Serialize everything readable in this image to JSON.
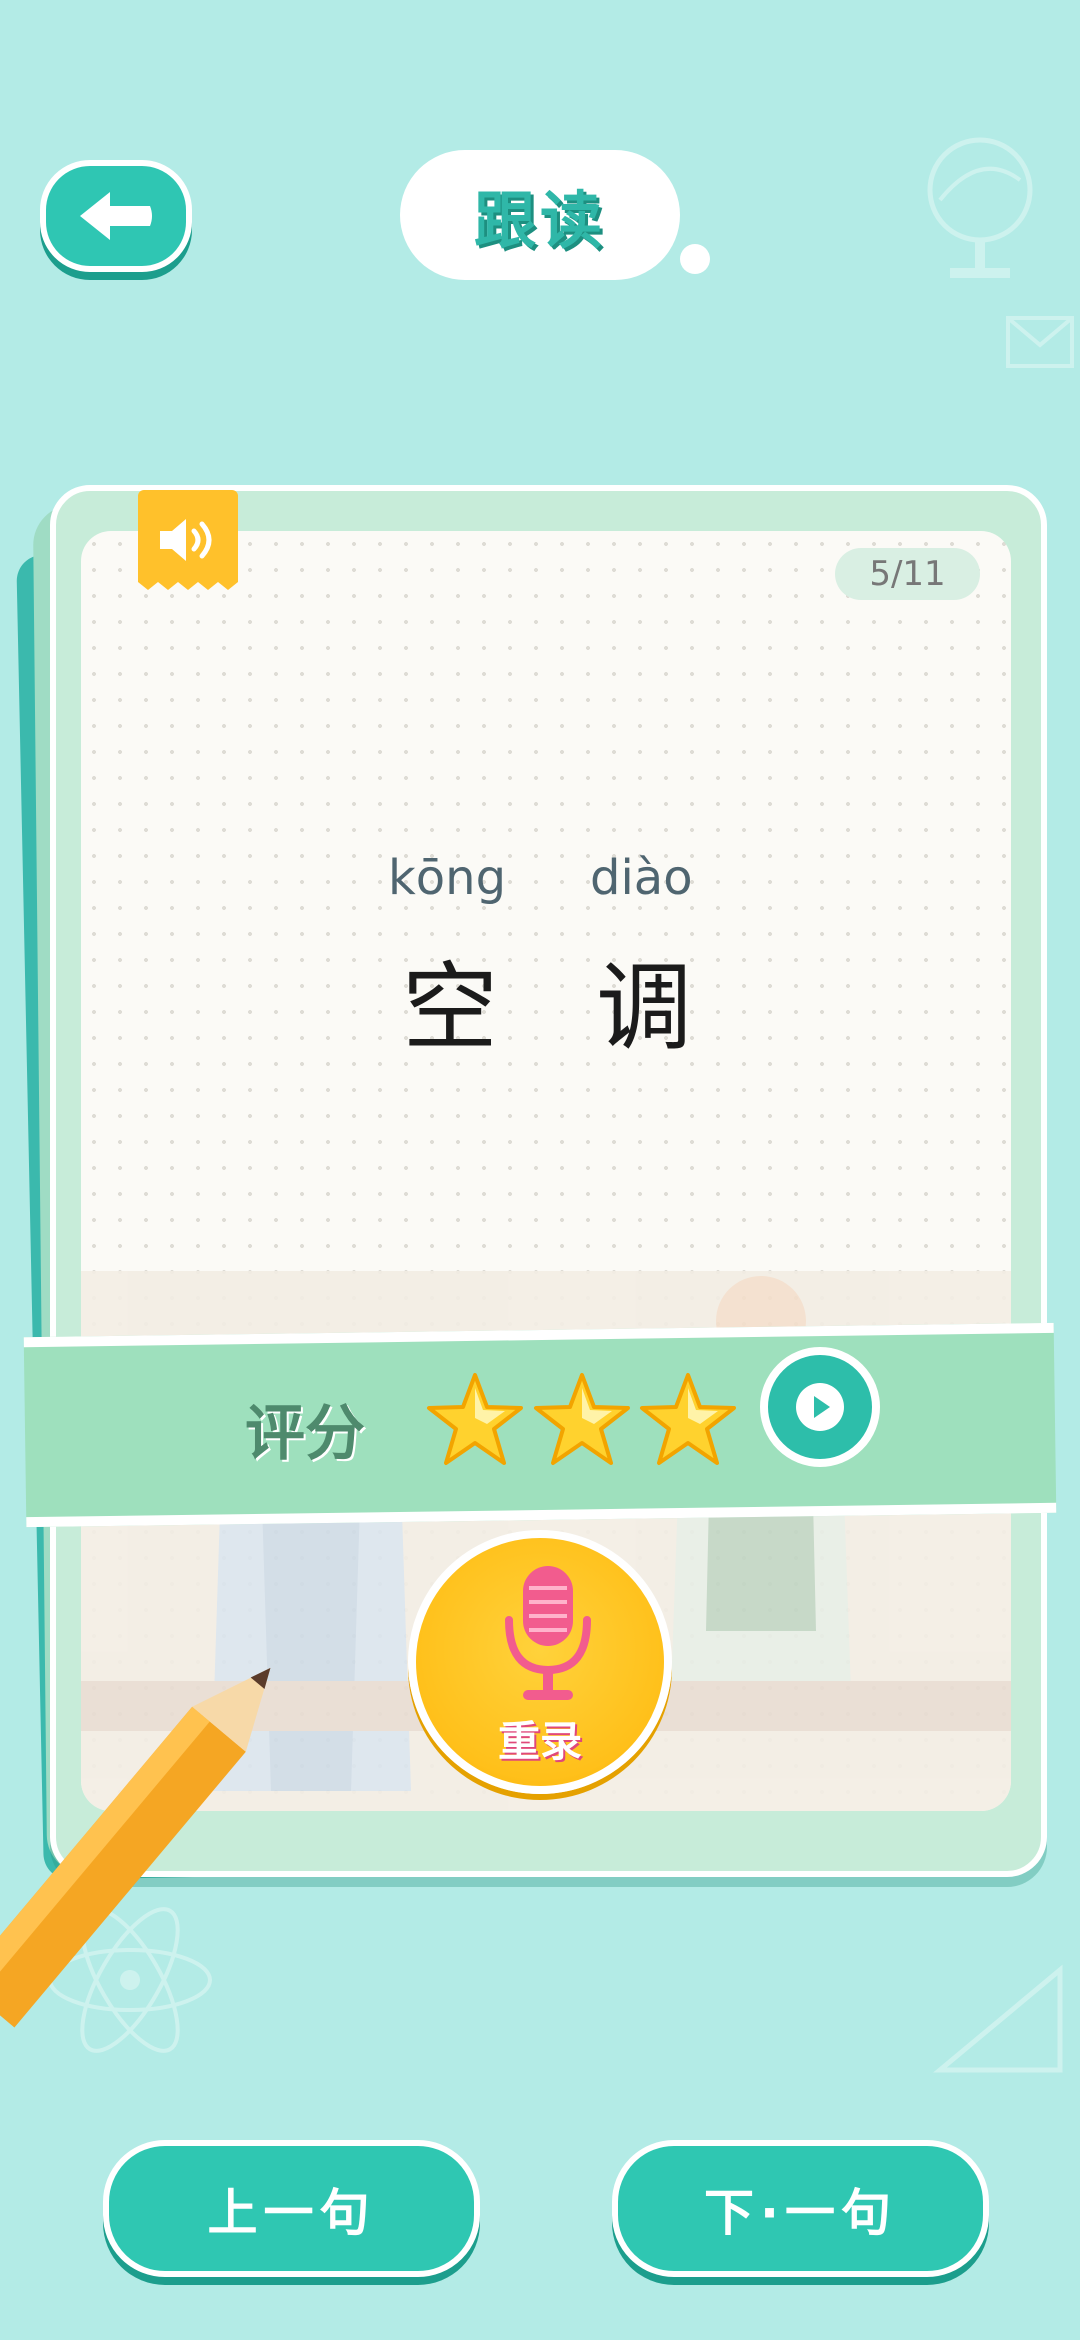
{
  "header": {
    "title": "跟读",
    "back_icon": "back-arrow-icon"
  },
  "card": {
    "counter": "5/11",
    "sound_icon": "speaker-icon",
    "words": [
      {
        "pinyin": "kōng",
        "hanzi": "空"
      },
      {
        "pinyin": "diào",
        "hanzi": "调"
      }
    ]
  },
  "score": {
    "label": "评分",
    "stars": 3,
    "max_stars": 3,
    "play_icon": "play-icon"
  },
  "record": {
    "label": "重录",
    "icon": "microphone-icon"
  },
  "nav": {
    "prev_label": "上一句",
    "next_label": "下·一句"
  },
  "colors": {
    "background": "#b3ebe6",
    "accent": "#2fc7b2",
    "card_border": "#c7ecd9",
    "banner": "#9ee0bd",
    "mic_button": "#ffc01a",
    "sound_tag": "#ffc12b",
    "star": "#ffd22e"
  }
}
